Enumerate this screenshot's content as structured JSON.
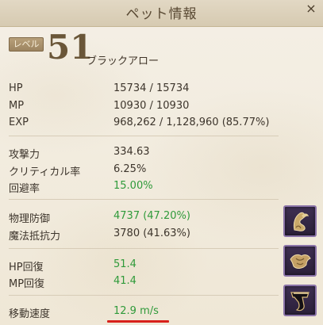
{
  "window": {
    "title": "ペット情報",
    "close_label": "×"
  },
  "pet": {
    "level_label": "レベル",
    "level": "51",
    "name": "ブラックアロー"
  },
  "stats": {
    "hp": {
      "label": "HP",
      "value": "15734 / 15734"
    },
    "mp": {
      "label": "MP",
      "value": "10930 / 10930"
    },
    "exp": {
      "label": "EXP",
      "value": "968,262 / 1,128,960 (85.77%)"
    },
    "attack": {
      "label": "攻撃力",
      "value": "334.63"
    },
    "critical": {
      "label": "クリティカル率",
      "value": "6.25%"
    },
    "evasion": {
      "label": "回避率",
      "value": "15.00%"
    },
    "phys_def": {
      "label": "物理防御",
      "value": "4737 (47.20%)"
    },
    "magic_res": {
      "label": "魔法抵抗力",
      "value": "3780 (41.63%)"
    },
    "hp_regen": {
      "label": "HP回復",
      "value": "51.4"
    },
    "mp_regen": {
      "label": "MP回復",
      "value": "41.4"
    },
    "move_speed": {
      "label": "移動速度",
      "value": "12.9 m/s"
    }
  },
  "colors": {
    "highlight_green": "#2f9a3a",
    "underline_red": "#d8211b",
    "slot_border": "#8a73a8"
  },
  "equipment_slots": [
    {
      "icon": "helmet-icon"
    },
    {
      "icon": "armor-icon"
    },
    {
      "icon": "claw-icon"
    }
  ]
}
